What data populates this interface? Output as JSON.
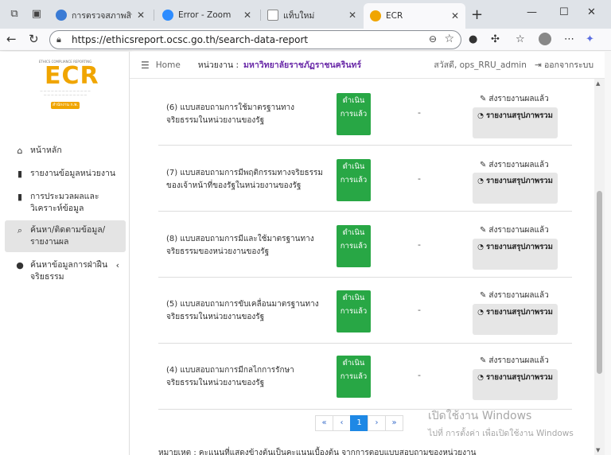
{
  "browser": {
    "tabs": [
      {
        "title": "การตรวจสภาพสินธิ์การขั้น",
        "fav_color": "#3a7bd5"
      },
      {
        "title": "Error - Zoom",
        "fav_color": "#2d8cff"
      },
      {
        "title": "แท็บใหม่",
        "fav_color": "#888888"
      },
      {
        "title": "ECR",
        "fav_color": "#f0a500"
      }
    ],
    "url": "https://ethicsreport.ocsc.go.th/search-data-report"
  },
  "logo": {
    "main": "ECR",
    "subtitle": "ETHICS COMPLIANCE REPORTING",
    "badge": "สำนักงาน ก.พ."
  },
  "sidebar": {
    "items": [
      {
        "label": "หน้าหลัก",
        "icon": "home-icon",
        "glyph": "⌂"
      },
      {
        "label": "รายงานข้อมูลหน่วยงาน",
        "icon": "document-icon",
        "glyph": "▮"
      },
      {
        "label": "การประมวลผลและวิเคราะห์ข้อมูล",
        "icon": "document-icon",
        "glyph": "▮"
      },
      {
        "label": "ค้นหา/ติดตามข้อมูล/รายงานผล",
        "icon": "search-icon",
        "glyph": "⌕"
      },
      {
        "label": "ค้นหาข้อมูลการฝ่าฝืนจริยธรรม",
        "icon": "circle-icon",
        "glyph": "●"
      }
    ]
  },
  "header": {
    "home": "Home",
    "unit_label": "หน่วยงาน :",
    "unit_value": "มหาวิทยาลัยราชภัฏราชนครินทร์",
    "user": "สวัสดี, ops_RRU_admin",
    "logout": "ออกจากระบบ"
  },
  "rows": [
    {
      "question": "(6) แบบสอบถามการใช้มาตรฐานทางจริยธรรมในหน่วยงานของรัฐ",
      "status": "ดำเนินการแล้ว",
      "score": "-",
      "sent": "ส่งรายงานผลแล้ว",
      "report": "รายงานสรุปภาพรวม"
    },
    {
      "question": "(7) แบบสอบถามการมีพฤติกรรมทางจริยธรรมของเจ้าหน้าที่ของรัฐในหน่วยงานของรัฐ",
      "status": "ดำเนินการแล้ว",
      "score": "-",
      "sent": "ส่งรายงานผลแล้ว",
      "report": "รายงานสรุปภาพรวม"
    },
    {
      "question": "(8) แบบสอบถามการมีและใช้มาตรฐานทางจริยธรรมของหน่วยงานของรัฐ",
      "status": "ดำเนินการแล้ว",
      "score": "-",
      "sent": "ส่งรายงานผลแล้ว",
      "report": "รายงานสรุปภาพรวม"
    },
    {
      "question": "(5) แบบสอบถามการขับเคลื่อนมาตรฐานทางจริยธรรมในหน่วยงานของรัฐ",
      "status": "ดำเนินการแล้ว",
      "score": "-",
      "sent": "ส่งรายงานผลแล้ว",
      "report": "รายงานสรุปภาพรวม"
    },
    {
      "question": "(4) แบบสอบถามการมีกลไกการรักษาจริยธรรมในหน่วยงานของรัฐ",
      "status": "ดำเนินการแล้ว",
      "score": "-",
      "sent": "ส่งรายงานผลแล้ว",
      "report": "รายงานสรุปภาพรวม"
    }
  ],
  "pagination": {
    "first": "«",
    "prev": "‹",
    "current": "1",
    "next": "›",
    "last": "»"
  },
  "footnote": "หมายเหตุ : คะแนนที่แสดงข้างต้นเป็นคะแนนเบื้องต้น จากการตอบแบบสอบถามของหน่วยงาน",
  "watermark": {
    "line1": "เปิดใช้งาน Windows",
    "line2": "ไปที่ การตั้งค่า เพื่อเปิดใช้งาน Windows"
  }
}
